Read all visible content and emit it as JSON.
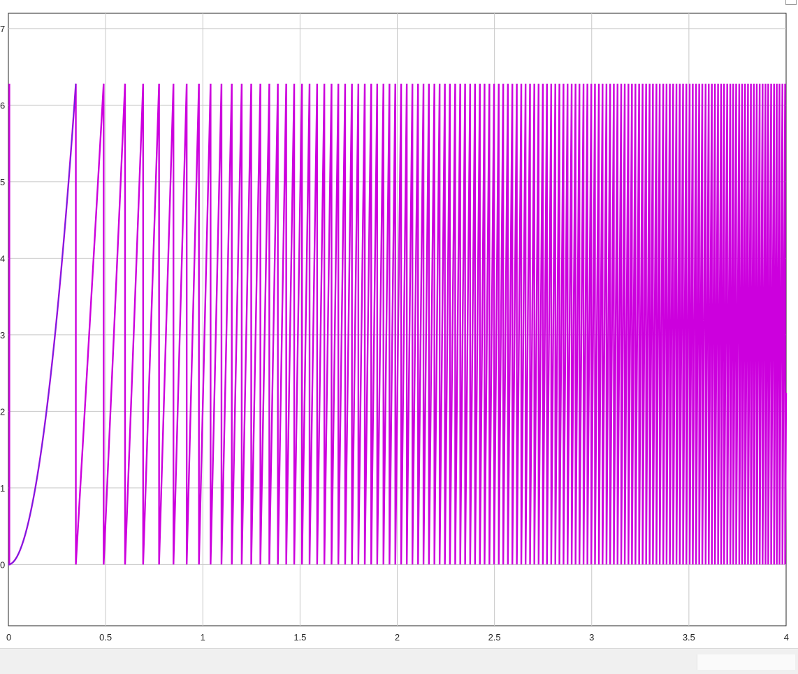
{
  "chart_data": {
    "type": "line",
    "title": "",
    "xlabel": "",
    "ylabel": "",
    "xlim": [
      0,
      4
    ],
    "ylim": [
      -0.8,
      7.2
    ],
    "xticks": [
      0,
      0.5,
      1,
      1.5,
      2,
      2.5,
      3,
      3.5,
      4
    ],
    "xtick_labels": [
      "0",
      "0.5",
      "1",
      "1.5",
      "2",
      "2.5",
      "3",
      "3.5",
      "4"
    ],
    "yticks": [
      0,
      1,
      2,
      3,
      4,
      5,
      6,
      7
    ],
    "ytick_labels": [
      "0",
      "1",
      "2",
      "3",
      "4",
      "5",
      "6",
      "7"
    ],
    "grid": true,
    "series": [
      {
        "color": "#cc00dd",
        "description_values": "sawtooth angle wrapping between 0 and 6.28 with linearly increasing frequency",
        "wrap_max": 6.28,
        "wrap_times": [
          0.347,
          0.49,
          0.6,
          0.693,
          0.775,
          0.849,
          0.917,
          0.98,
          1.04,
          1.096,
          1.149,
          1.2,
          1.249,
          1.296,
          1.342,
          1.386,
          1.429,
          1.47,
          1.51,
          1.549,
          1.588,
          1.625,
          1.662,
          1.697,
          1.732,
          1.767,
          1.8,
          1.833,
          1.866,
          1.897,
          1.929,
          1.96,
          1.99,
          2.02,
          2.049,
          2.078,
          2.107,
          2.135,
          2.163,
          2.191,
          2.218,
          2.245,
          2.271,
          2.298,
          2.324,
          2.349,
          2.375,
          2.4,
          2.425,
          2.449,
          2.474,
          2.498,
          2.522,
          2.545,
          2.569,
          2.592,
          2.615,
          2.638,
          2.66,
          2.683,
          2.705,
          2.727,
          2.749,
          2.77,
          2.792,
          2.813,
          2.834,
          2.855,
          2.876,
          2.897,
          2.917,
          2.937,
          2.958,
          2.978,
          2.998,
          3.017,
          3.037,
          3.056,
          3.076,
          3.095,
          3.114,
          3.133,
          3.152,
          3.17,
          3.189,
          3.207,
          3.225,
          3.244,
          3.262,
          3.28,
          3.298,
          3.315,
          3.333,
          3.35,
          3.368,
          3.385,
          3.402,
          3.419,
          3.436,
          3.453,
          3.47,
          3.487,
          3.504,
          3.52,
          3.537,
          3.553,
          3.569,
          3.586,
          3.602,
          3.618,
          3.634,
          3.65,
          3.666,
          3.681,
          3.697,
          3.713,
          3.728,
          3.743,
          3.759,
          3.774,
          3.789,
          3.804,
          3.819,
          3.834,
          3.849,
          3.864,
          3.879,
          3.894,
          3.908,
          3.923,
          3.938,
          3.952,
          3.966,
          3.981,
          3.995
        ]
      }
    ]
  }
}
